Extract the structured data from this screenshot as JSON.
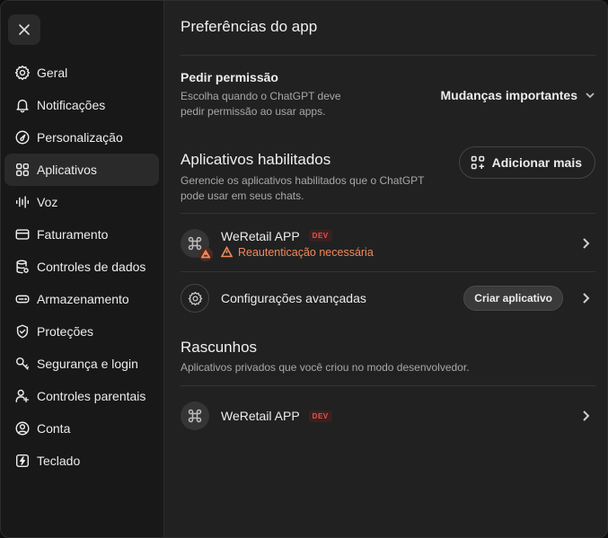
{
  "sidebar": {
    "close_icon": "close-icon",
    "items": [
      {
        "label": "Geral",
        "icon": "gear-icon"
      },
      {
        "label": "Notificações",
        "icon": "bell-icon"
      },
      {
        "label": "Personalização",
        "icon": "personalization-icon"
      },
      {
        "label": "Aplicativos",
        "icon": "apps-icon"
      },
      {
        "label": "Voz",
        "icon": "voice-icon"
      },
      {
        "label": "Faturamento",
        "icon": "credit-card-icon"
      },
      {
        "label": "Controles de dados",
        "icon": "database-icon"
      },
      {
        "label": "Armazenamento",
        "icon": "storage-icon"
      },
      {
        "label": "Proteções",
        "icon": "shield-icon"
      },
      {
        "label": "Segurança e login",
        "icon": "key-icon"
      },
      {
        "label": "Controles parentais",
        "icon": "family-icon"
      },
      {
        "label": "Conta",
        "icon": "account-icon"
      },
      {
        "label": "Teclado",
        "icon": "keyboard-icon"
      }
    ],
    "active_item": "Aplicativos"
  },
  "main": {
    "title": "Preferências do app",
    "permission": {
      "title": "Pedir permissão",
      "description": "Escolha quando o ChatGPT deve pedir permissão ao usar apps.",
      "selected": "Mudanças importantes"
    },
    "enabled": {
      "title": "Aplicativos habilitados",
      "description": "Gerencie os aplicativos habilitados que o ChatGPT pode usar em seus chats.",
      "add_label": "Adicionar mais",
      "apps": [
        {
          "name": "WeRetail APP",
          "badge": "DEV",
          "warning": "Reautenticação necessária"
        }
      ],
      "advanced_label": "Configurações avançadas",
      "create_label": "Criar aplicativo"
    },
    "drafts": {
      "title": "Rascunhos",
      "description": "Aplicativos privados que você criou no modo desenvolvedor.",
      "apps": [
        {
          "name": "WeRetail APP",
          "badge": "DEV"
        }
      ]
    }
  },
  "colors": {
    "background": "#212121",
    "sidebar": "#181818",
    "warning": "#f08a5d",
    "dev_badge": "#e5544f"
  }
}
